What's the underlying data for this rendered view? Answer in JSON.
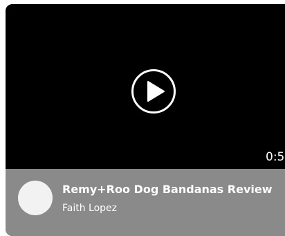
{
  "video": {
    "duration": "0:5",
    "play_icon": "play-circle-icon"
  },
  "info": {
    "title": "Remy+Roo Dog Bandanas Review",
    "author": "Faith Lopez"
  },
  "colors": {
    "video_background": "#000000",
    "footer_background": "#8a8a8a",
    "avatar": "#f2f2f2",
    "text": "#ffffff"
  }
}
